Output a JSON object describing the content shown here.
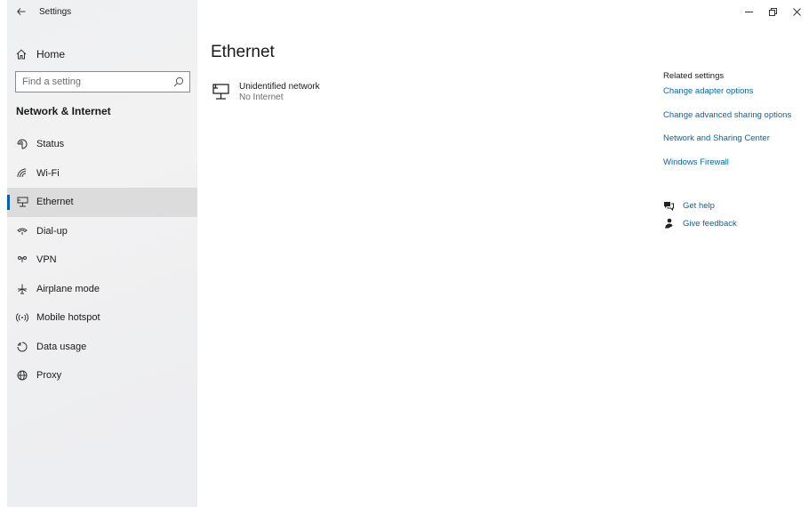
{
  "window": {
    "app_title": "Settings"
  },
  "sidebar": {
    "home_label": "Home",
    "search_placeholder": "Find a setting",
    "section_title": "Network & Internet",
    "items": [
      {
        "label": "Status",
        "icon": "status-icon"
      },
      {
        "label": "Wi-Fi",
        "icon": "wifi-icon"
      },
      {
        "label": "Ethernet",
        "icon": "ethernet-icon",
        "selected": true
      },
      {
        "label": "Dial-up",
        "icon": "dialup-icon"
      },
      {
        "label": "VPN",
        "icon": "vpn-icon"
      },
      {
        "label": "Airplane mode",
        "icon": "airplane-icon"
      },
      {
        "label": "Mobile hotspot",
        "icon": "hotspot-icon"
      },
      {
        "label": "Data usage",
        "icon": "data-usage-icon"
      },
      {
        "label": "Proxy",
        "icon": "globe-icon"
      }
    ]
  },
  "main": {
    "title": "Ethernet",
    "network": {
      "name": "Unidentified network",
      "status": "No Internet"
    },
    "related": {
      "title": "Related settings",
      "links": [
        "Change adapter options",
        "Change advanced sharing options",
        "Network and Sharing Center",
        "Windows Firewall"
      ]
    },
    "help": {
      "get_help": "Get help",
      "give_feedback": "Give feedback"
    }
  },
  "colors": {
    "accent": "#0063b1",
    "link": "#0066b4",
    "selected_bg": "#dcdcdc"
  }
}
